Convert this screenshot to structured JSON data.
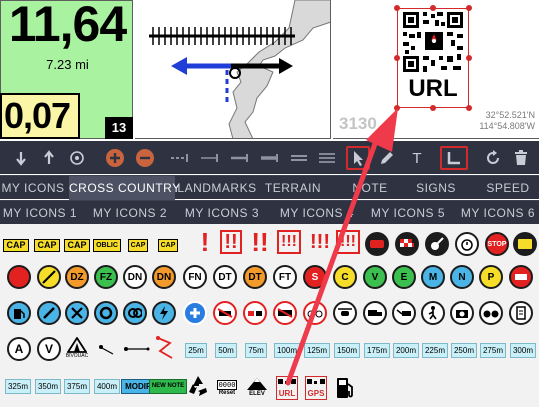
{
  "dashboard": {
    "distance_value": "11,64",
    "distance_miles": "7.23 mi",
    "partial_value": "0,07",
    "number_badge": "13"
  },
  "qr_panel": {
    "url_label": "URL",
    "faded_number": "3130",
    "coord_lat": "32°52.521'N",
    "coord_lon": "114°54.808'W"
  },
  "toolbar": {
    "text_tool_label": "T"
  },
  "tabs_row1": [
    "MY ICONS",
    "CROSS COUNTRY",
    "LANDMARKS",
    "TERRAIN",
    "NOTE",
    "SIGNS",
    "SPEED"
  ],
  "tabs_row1_active": "CROSS COUNTRY",
  "tabs_row2": [
    "MY ICONS 1",
    "MY ICONS 2",
    "MY ICONS 3",
    "MY ICONS 4",
    "MY ICONS 5",
    "MY ICONS 6"
  ],
  "grid": {
    "row1_tags": [
      "CAP",
      "CAP",
      "CAP",
      "OBLIC",
      "CAP",
      "CAP"
    ],
    "row1_excl": [
      "!",
      "!!",
      "!!",
      "!!!",
      "!!!",
      "!!!"
    ],
    "row2_circles": [
      "DZ",
      "FZ",
      "DN",
      "DN",
      "FN",
      "DT",
      "DT",
      "FT",
      "S",
      "C",
      "V",
      "E",
      "M",
      "N",
      "P"
    ],
    "row4_letters": [
      "A",
      "V"
    ],
    "row4_label": "BIVOUAC",
    "row4_distances": [
      "25m",
      "50m",
      "75m",
      "100m",
      "125m",
      "150m",
      "175m",
      "200m",
      "225m",
      "250m",
      "275m",
      "300m"
    ],
    "row5_distances": [
      "325m",
      "350m",
      "375m",
      "400m"
    ],
    "modif_label": "MODIF",
    "new_note_label": "NEW NOTE",
    "reset_digits": "0000",
    "reset_label": "Reset",
    "elev_label": "ELEV",
    "url_icon_label": "URL",
    "gps_icon_label": "GPS"
  },
  "colors": {
    "green_panel": "#a9f2a0",
    "yellow_box": "#fbf5a7",
    "toolbar_bg": "#2f3341",
    "accent_red": "#d32b2b",
    "distance_chip": "#c9f0f8"
  }
}
